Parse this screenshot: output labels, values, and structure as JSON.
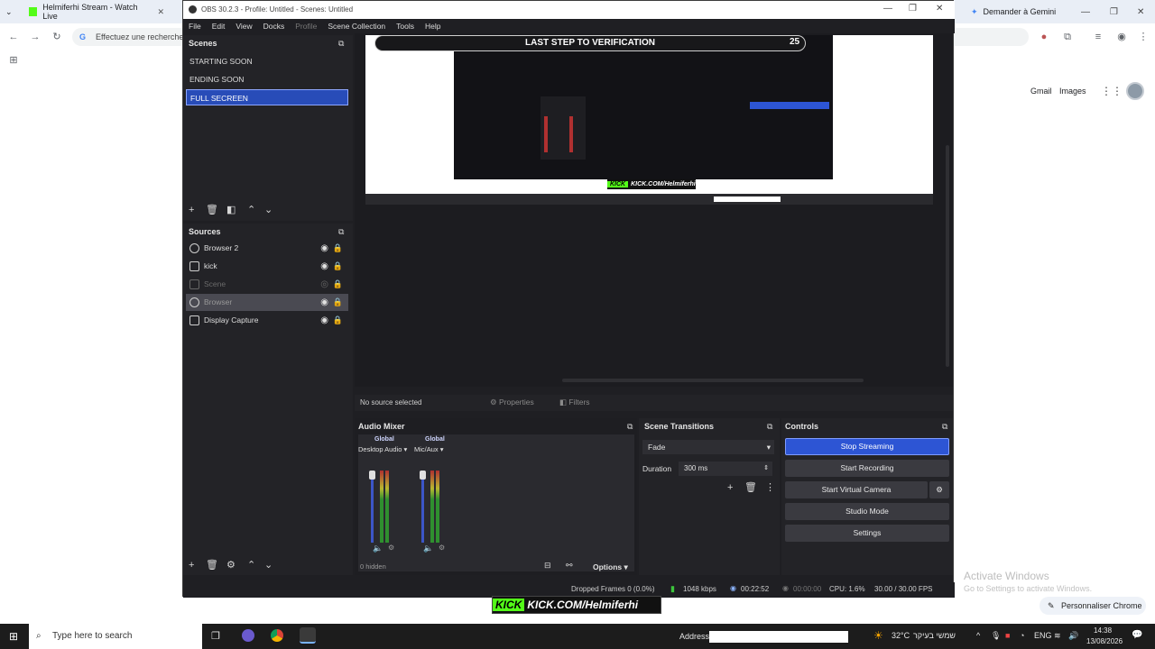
{
  "chrome": {
    "tab1_title": "Helmiferhi Stream - Watch Live",
    "gemini_label": "Demander à Gemini",
    "omnibox_text": "Effectuez une recherche",
    "gmail": "Gmail",
    "images": "Images",
    "activate_windows": "Activate Windows",
    "activate_sub": "Go to Settings to activate Windows.",
    "customize": "Personnaliser Chrome"
  },
  "obs": {
    "title": "OBS 30.2.3 - Profile: Untitled - Scenes: Untitled",
    "menu": [
      "File",
      "Edit",
      "View",
      "Docks",
      "Profile",
      "Scene Collection",
      "Tools",
      "Help"
    ],
    "scenes_title": "Scenes",
    "scenes": [
      "STARTING SOON",
      "ENDING SOON",
      "FULL SECREEN"
    ],
    "sources_title": "Sources",
    "sources": [
      {
        "name": "Browser 2",
        "icon": "globe-icon"
      },
      {
        "name": "kick",
        "icon": "image-icon"
      },
      {
        "name": "Scene",
        "icon": "camera-icon"
      },
      {
        "name": "Browser",
        "icon": "globe-icon"
      },
      {
        "name": "Display Capture",
        "icon": "monitor-icon"
      }
    ],
    "preview": {
      "verify_text": "LAST STEP TO VERIFICATION",
      "verify_count": "25",
      "kick_url": "KICK.COM/Helmiferhi"
    },
    "no_source": "No source selected",
    "properties": "Properties",
    "filters": "Filters",
    "audio_mixer": {
      "title": "Audio Mixer",
      "channels": [
        {
          "name": "Desktop Audio",
          "tag": "Global"
        },
        {
          "name": "Mic/Aux",
          "tag": "Global"
        }
      ],
      "hidden": "0 hidden",
      "options": "Options"
    },
    "transitions": {
      "title": "Scene Transitions",
      "type": "Fade",
      "duration_label": "Duration",
      "duration_value": "300 ms"
    },
    "controls": {
      "title": "Controls",
      "buttons": [
        "Stop Streaming",
        "Start Recording",
        "Start Virtual Camera",
        "Studio Mode",
        "Settings"
      ]
    },
    "status": {
      "dropped": "Dropped Frames 0 (0.0%)",
      "bitrate": "1048 kbps",
      "stream_time": "00:22:52",
      "rec_time": "00:00:00",
      "cpu": "CPU: 1.6%",
      "fps": "30.00 / 30.00 FPS"
    }
  },
  "taskbar": {
    "search": "Type here to search",
    "address_label": "Address",
    "weather": "32°C",
    "weather_text": "שמשי בעיקר",
    "lang": "ENG",
    "time": "14:38",
    "date": "13/08/2026"
  },
  "colors": {
    "obs_bg": "#1f1f23",
    "accent_blue": "#2d55d4",
    "kick_green": "#53fc18"
  }
}
